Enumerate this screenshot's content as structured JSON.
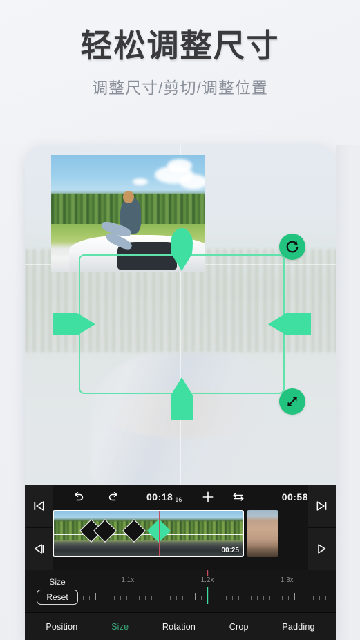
{
  "header": {
    "title": "轻松调整尺寸",
    "subtitle": "调整尺寸/剪切/调整位置"
  },
  "preview": {
    "crop_frame_label": "crop-frame",
    "handles": {
      "top": "top-resize-handle",
      "bottom": "bottom-resize-handle",
      "left": "left-resize-handle",
      "right": "right-resize-handle",
      "rotate_icon": "rotate-icon",
      "resize_icon": "diagonal-resize-icon"
    }
  },
  "editor": {
    "nav": {
      "skip_to_start_icon": "skip-to-start-icon",
      "step_back_icon": "step-backward-icon",
      "skip_to_end_icon": "skip-to-end-icon",
      "step_forward_icon": "step-forward-icon"
    },
    "toolbar": {
      "undo_icon": "undo-icon",
      "redo_icon": "redo-icon",
      "current_time": "00:18",
      "current_frame": "16",
      "add_icon": "plus-icon",
      "swap_icon": "swap-icon",
      "total_time": "00:58"
    },
    "timeline": {
      "clip_duration": "00:25",
      "keyframes": [
        {
          "position_pct": 20,
          "active": false
        },
        {
          "position_pct": 28,
          "active": false
        },
        {
          "position_pct": 42,
          "active": false
        },
        {
          "position_pct": 55,
          "active": true
        }
      ],
      "playhead_pct": 55,
      "trim_left_icon": ">",
      "trim_right_icon": "<"
    },
    "slider": {
      "label": "Size",
      "reset_label": "Reset",
      "ticks": [
        "1.1x",
        "1.2x",
        "1.3x"
      ],
      "current_value": "1.2x",
      "needle_pct": 50
    },
    "tabs": [
      {
        "label": "Position",
        "active": false
      },
      {
        "label": "Size",
        "active": true
      },
      {
        "label": "Rotation",
        "active": false
      },
      {
        "label": "Crop",
        "active": false
      },
      {
        "label": "Padding",
        "active": false
      }
    ]
  },
  "colors": {
    "accent_green": "#3fdfa2",
    "accent_green_dark": "#22c27f",
    "tab_active": "#3aa87a",
    "playhead_red": "#c94b5e",
    "panel_bg": "#141414",
    "title_text": "#3a3a3c",
    "subtitle_text": "#8a9099"
  }
}
